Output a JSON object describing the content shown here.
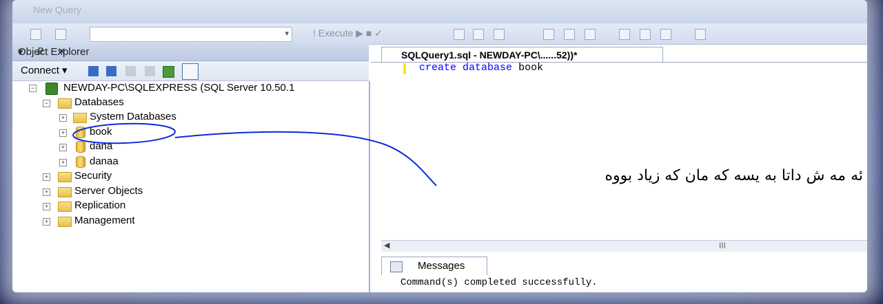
{
  "toolbar": {
    "new_query_label": "New Query",
    "execute_label": "Execute"
  },
  "object_explorer": {
    "title": "Object Explorer",
    "pin_controls": "▾ ₽ ✕",
    "connect_label": "Connect ▾",
    "server": "NEWDAY-PC\\SQLEXPRESS (SQL Server 10.50.1",
    "databases_label": "Databases",
    "system_databases_label": "System Databases",
    "user_databases": [
      "book",
      "dana",
      "danaa"
    ],
    "security_label": "Security",
    "server_objects_label": "Server Objects",
    "replication_label": "Replication",
    "management_label": "Management"
  },
  "editor": {
    "tab_title": "SQLQuery1.sql - NEWDAY-PC\\......52))*",
    "code_keyword1": "create",
    "code_keyword2": "database",
    "code_identifier": "book",
    "hscroll_dots": "III"
  },
  "messages": {
    "tab_label": "Messages",
    "text": "Command(s) completed successfully."
  },
  "annotation": {
    "text": "ئه مه ش داتا به یسه که مان که زیاد بووه",
    "color": "#0a2bd6"
  },
  "colors": {
    "frame_bg": "#0a1a4a",
    "keyword": "#0000ff",
    "highlight_line": "#ffe900"
  }
}
